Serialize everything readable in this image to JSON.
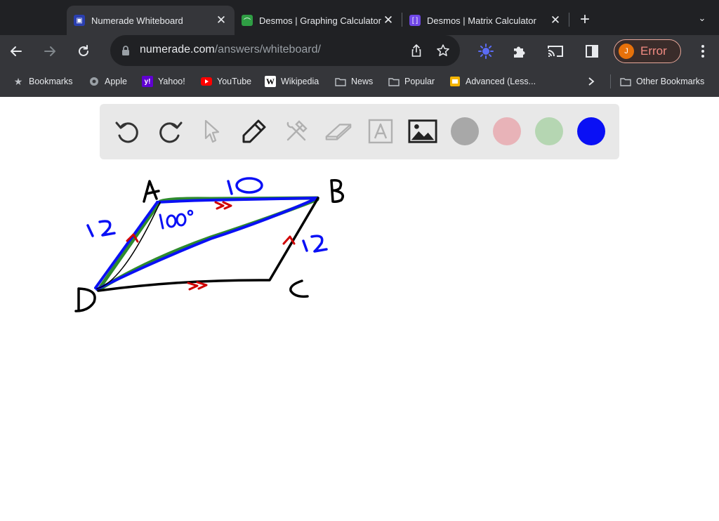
{
  "tabs": [
    {
      "title": "Numerade Whiteboard",
      "favicon_icon": "numerade-icon",
      "color": "#3b5bdb"
    },
    {
      "title": "Desmos | Graphing Calculator",
      "favicon_icon": "desmos-graphing-icon",
      "color": "#2f9e44"
    },
    {
      "title": "Desmos | Matrix Calculator",
      "favicon_icon": "desmos-matrix-icon",
      "color": "#7048e8"
    }
  ],
  "address": {
    "domain": "numerade.com",
    "path": "/answers/whiteboard/"
  },
  "profile": {
    "initial": "J",
    "status": "Error"
  },
  "bookmarks": [
    {
      "label": "Bookmarks",
      "icon": "star-icon"
    },
    {
      "label": "Apple",
      "icon": "apple-icon"
    },
    {
      "label": "Yahoo!",
      "icon": "yahoo-icon"
    },
    {
      "label": "YouTube",
      "icon": "youtube-icon"
    },
    {
      "label": "Wikipedia",
      "icon": "wikipedia-icon"
    },
    {
      "label": "News",
      "icon": "folder-icon"
    },
    {
      "label": "Popular",
      "icon": "folder-icon"
    },
    {
      "label": "Advanced (Less...",
      "icon": "slides-icon"
    },
    {
      "label": "Other Bookmarks",
      "icon": "folder-icon"
    }
  ],
  "whiteboard": {
    "tools": [
      "undo",
      "redo",
      "select",
      "pen",
      "tools",
      "eraser",
      "text",
      "image"
    ],
    "colors": [
      "#a8a8a8",
      "#e8b3b8",
      "#b5d6b2",
      "#0a10f5"
    ],
    "labels": {
      "A": "A",
      "B": "B",
      "C": "C",
      "D": "D",
      "AB": "10",
      "AD": "12",
      "BC": "12",
      "angle": "100°"
    }
  }
}
